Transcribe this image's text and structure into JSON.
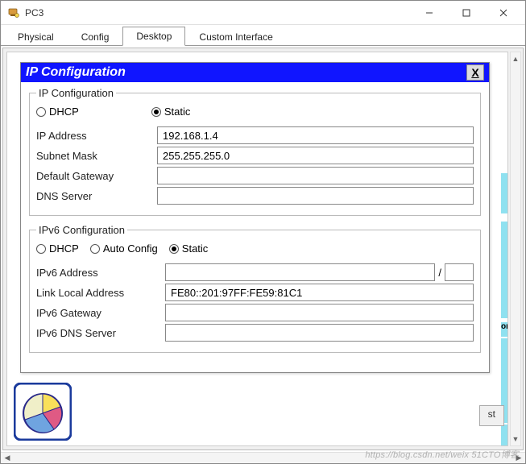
{
  "window": {
    "title": "PC3"
  },
  "tabs": [
    "Physical",
    "Config",
    "Desktop",
    "Custom Interface"
  ],
  "activeTab": "Desktop",
  "dialog": {
    "title": "IP Configuration",
    "close": "X",
    "ipv4": {
      "legend": "IP Configuration",
      "modes": {
        "dhcp": "DHCP",
        "static": "Static"
      },
      "selectedMode": "Static",
      "fields": {
        "ipAddress": {
          "label": "IP Address",
          "value": "192.168.1.4"
        },
        "subnetMask": {
          "label": "Subnet Mask",
          "value": "255.255.255.0"
        },
        "defaultGateway": {
          "label": "Default Gateway",
          "value": ""
        },
        "dnsServer": {
          "label": "DNS Server",
          "value": ""
        }
      }
    },
    "ipv6": {
      "legend": "IPv6 Configuration",
      "modes": {
        "dhcp": "DHCP",
        "auto": "Auto Config",
        "static": "Static"
      },
      "selectedMode": "Static",
      "fields": {
        "ipv6Address": {
          "label": "IPv6 Address",
          "value": "",
          "prefix": ""
        },
        "linkLocal": {
          "label": "Link Local Address",
          "value": "FE80::201:97FF:FE59:81C1"
        },
        "ipv6Gateway": {
          "label": "IPv6 Gateway",
          "value": ""
        },
        "ipv6Dns": {
          "label": "IPv6 DNS Server",
          "value": ""
        }
      },
      "slash": "/"
    }
  },
  "sideBtn": "st",
  "orLabel": "or",
  "watermark": "https://blog.csdn.net/weix   51CTO博客"
}
